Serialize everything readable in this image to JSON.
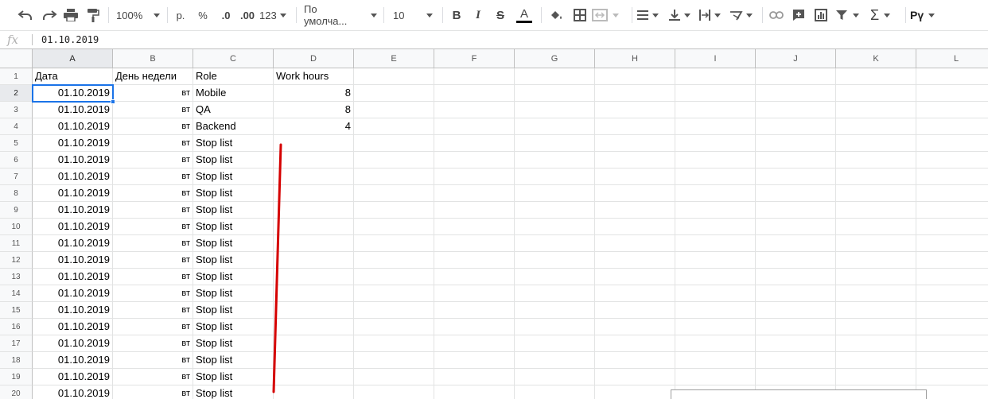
{
  "toolbar": {
    "zoom": "100%",
    "currency": "р.",
    "percent": "%",
    "decrease_decimal": ".0",
    "increase_decimal": ".00",
    "more_formats": "123",
    "font_name": "По умолча...",
    "font_size": "10",
    "input_tools": "Рү",
    "text_color": "#000000"
  },
  "formula_bar": {
    "fx": "fx",
    "value": "01.10.2019"
  },
  "columns": [
    "A",
    "B",
    "C",
    "D",
    "E",
    "F",
    "G",
    "H",
    "I",
    "J",
    "K",
    "L"
  ],
  "selected_cell": "A2",
  "rows": [
    {
      "num": "1",
      "a": "Дата",
      "b": "День недели",
      "c": "Role",
      "d": "Work hours"
    },
    {
      "num": "2",
      "a": "01.10.2019",
      "b": "вт",
      "c": "Mobile",
      "d": "8"
    },
    {
      "num": "3",
      "a": "01.10.2019",
      "b": "вт",
      "c": "QA",
      "d": "8"
    },
    {
      "num": "4",
      "a": "01.10.2019",
      "b": "вт",
      "c": "Backend",
      "d": "4"
    },
    {
      "num": "5",
      "a": "01.10.2019",
      "b": "вт",
      "c": "Stop list",
      "d": ""
    },
    {
      "num": "6",
      "a": "01.10.2019",
      "b": "вт",
      "c": "Stop list",
      "d": ""
    },
    {
      "num": "7",
      "a": "01.10.2019",
      "b": "вт",
      "c": "Stop list",
      "d": ""
    },
    {
      "num": "8",
      "a": "01.10.2019",
      "b": "вт",
      "c": "Stop list",
      "d": ""
    },
    {
      "num": "9",
      "a": "01.10.2019",
      "b": "вт",
      "c": "Stop list",
      "d": ""
    },
    {
      "num": "10",
      "a": "01.10.2019",
      "b": "вт",
      "c": "Stop list",
      "d": ""
    },
    {
      "num": "11",
      "a": "01.10.2019",
      "b": "вт",
      "c": "Stop list",
      "d": ""
    },
    {
      "num": "12",
      "a": "01.10.2019",
      "b": "вт",
      "c": "Stop list",
      "d": ""
    },
    {
      "num": "13",
      "a": "01.10.2019",
      "b": "вт",
      "c": "Stop list",
      "d": ""
    },
    {
      "num": "14",
      "a": "01.10.2019",
      "b": "вт",
      "c": "Stop list",
      "d": ""
    },
    {
      "num": "15",
      "a": "01.10.2019",
      "b": "вт",
      "c": "Stop list",
      "d": ""
    },
    {
      "num": "16",
      "a": "01.10.2019",
      "b": "вт",
      "c": "Stop list",
      "d": ""
    },
    {
      "num": "17",
      "a": "01.10.2019",
      "b": "вт",
      "c": "Stop list",
      "d": ""
    },
    {
      "num": "18",
      "a": "01.10.2019",
      "b": "вт",
      "c": "Stop list",
      "d": ""
    },
    {
      "num": "19",
      "a": "01.10.2019",
      "b": "вт",
      "c": "Stop list",
      "d": ""
    },
    {
      "num": "20",
      "a": "01.10.2019",
      "b": "вт",
      "c": "Stop list",
      "d": ""
    }
  ],
  "colors": {
    "selection": "#1a73e8",
    "annotation_line": "#d50000"
  }
}
